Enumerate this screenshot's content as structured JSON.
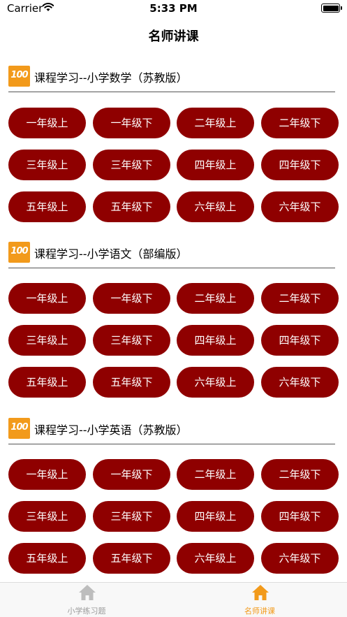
{
  "status_bar": {
    "carrier": "Carrier",
    "time": "5:33 PM"
  },
  "nav": {
    "title": "名师讲课"
  },
  "colors": {
    "button_bg": "#8f0000",
    "button_text": "#ffffff",
    "logo": "#f29a1b",
    "tab_active": "#f29a1b",
    "tab_inactive": "#bdbdbd"
  },
  "sections": [
    {
      "logo": "100",
      "title": "课程学习--小学数学（苏教版）",
      "grades": [
        "一年级上",
        "一年级下",
        "二年级上",
        "二年级下",
        "三年级上",
        "三年级下",
        "四年级上",
        "四年级下",
        "五年级上",
        "五年级下",
        "六年级上",
        "六年级下"
      ]
    },
    {
      "logo": "100",
      "title": "课程学习--小学语文（部编版）",
      "grades": [
        "一年级上",
        "一年级下",
        "二年级上",
        "二年级下",
        "三年级上",
        "三年级下",
        "四年级上",
        "四年级下",
        "五年级上",
        "五年级下",
        "六年级上",
        "六年级下"
      ]
    },
    {
      "logo": "100",
      "title": "课程学习--小学英语（苏教版）",
      "grades": [
        "一年级上",
        "一年级下",
        "二年级上",
        "二年级下",
        "三年级上",
        "三年级下",
        "四年级上",
        "四年级下",
        "五年级上",
        "五年级下",
        "六年级上",
        "六年级下"
      ]
    }
  ],
  "tab_bar": {
    "tabs": [
      {
        "label": "小学练习题",
        "icon": "home-icon",
        "active": false
      },
      {
        "label": "名师讲课",
        "icon": "home-icon",
        "active": true
      }
    ]
  }
}
